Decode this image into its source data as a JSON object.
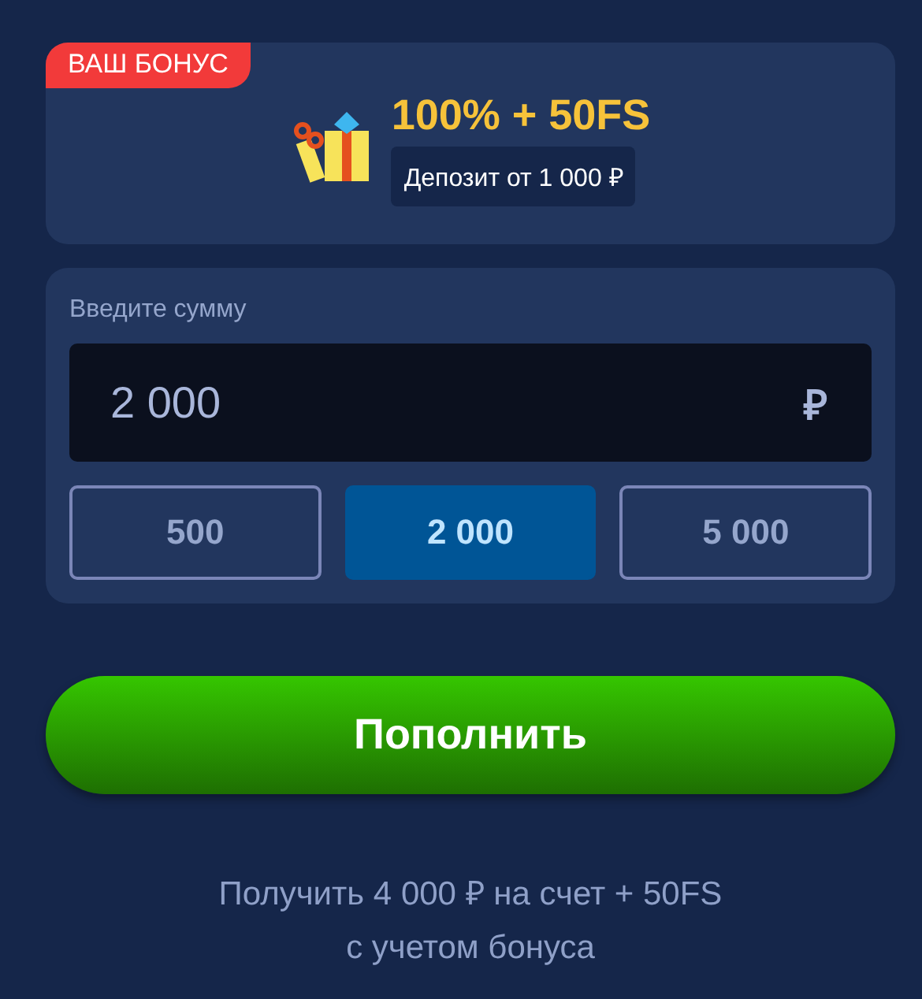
{
  "bonus": {
    "badge": "ВАШ БОНУС",
    "title": "100% + 50FS",
    "condition": "Депозит от 1 000 ₽"
  },
  "amount": {
    "label": "Введите сумму",
    "value": "2 000",
    "currency": "₽",
    "presets": [
      {
        "label": "500",
        "selected": false
      },
      {
        "label": "2 000",
        "selected": true
      },
      {
        "label": "5 000",
        "selected": false
      }
    ]
  },
  "submit": "Пополнить",
  "footer": [
    "Получить 4 000 ₽ на счет + 50FS",
    "с учетом бонуса"
  ]
}
